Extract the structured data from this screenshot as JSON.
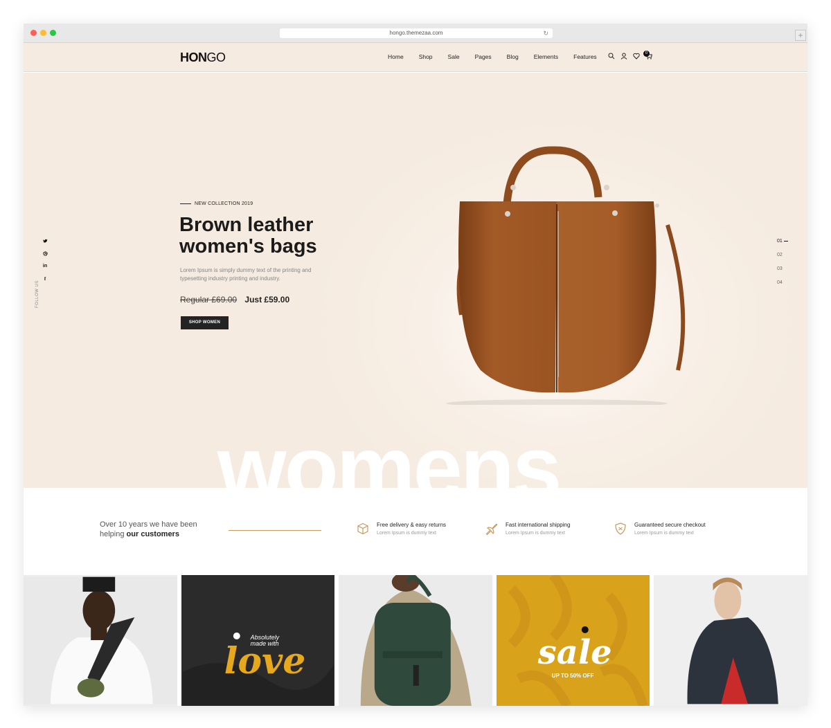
{
  "browser": {
    "url": "hongo.themezaa.com"
  },
  "header": {
    "logo_bold": "HON",
    "logo_light": "GO",
    "nav": [
      "Home",
      "Shop",
      "Sale",
      "Pages",
      "Blog",
      "Elements",
      "Features"
    ],
    "cart_count": "0"
  },
  "hero": {
    "kicker": "NEW COLLECTION 2019",
    "title": "Brown leather women's bags",
    "description": "Lorem Ipsum is simply dummy text of the printing and typesetting industry printing and industry.",
    "price_old": "Regular £69.00",
    "price_new": "Just £59.00",
    "button": "SHOP WOMEN",
    "big_word": "womens",
    "follow_label": "FOLLOW US",
    "slides": [
      "01",
      "02",
      "03",
      "04"
    ]
  },
  "features_strip": {
    "tagline_line1": "Over 10 years we have been",
    "tagline_line2a": "helping ",
    "tagline_line2b": "our customers",
    "items": [
      {
        "title": "Free delivery & easy returns",
        "desc": "Lorem Ipsum is dummy text",
        "icon": "box-icon"
      },
      {
        "title": "Fast international shipping",
        "desc": "Lorem Ipsum is dummy text",
        "icon": "plane-icon"
      },
      {
        "title": "Guaranteed secure checkout",
        "desc": "Lorem Ipsum is dummy text",
        "icon": "shield-icon"
      }
    ]
  },
  "tiles": {
    "love_small": "Absolutely made with",
    "love_big": "love",
    "sale_big": "sale",
    "sale_small": "UP TO 50% OFF"
  },
  "colors": {
    "accent": "#c89a5a",
    "hero_bg": "#f5ebe0",
    "bag": "#a65a26",
    "sale_tile": "#d9a21b"
  }
}
